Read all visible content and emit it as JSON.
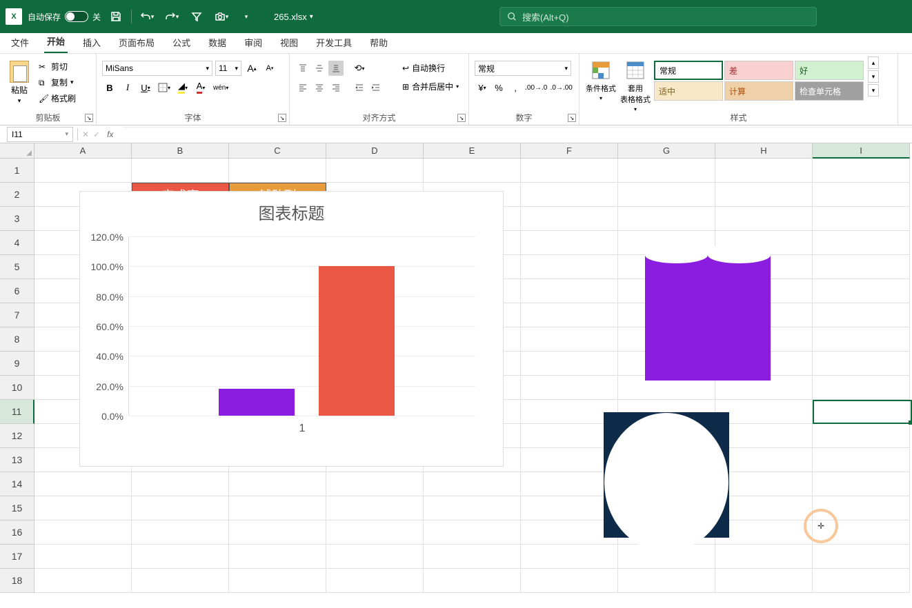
{
  "title_bar": {
    "autosave_label": "自动保存",
    "autosave_state": "关",
    "file_name": "265.xlsx"
  },
  "search": {
    "placeholder": "搜索(Alt+Q)"
  },
  "tabs": {
    "file": "文件",
    "home": "开始",
    "insert": "插入",
    "layout": "页面布局",
    "formulas": "公式",
    "data": "数据",
    "review": "审阅",
    "view": "视图",
    "dev": "开发工具",
    "help": "帮助"
  },
  "ribbon": {
    "clipboard": {
      "paste": "粘贴",
      "cut": "剪切",
      "copy": "复制",
      "painter": "格式刷",
      "label": "剪贴板"
    },
    "font": {
      "name": "MiSans",
      "size": "11",
      "label": "字体",
      "phonetic": "wén"
    },
    "align": {
      "wrap": "自动换行",
      "merge": "合并后居中",
      "label": "对齐方式"
    },
    "number": {
      "format": "常规",
      "label": "数字"
    },
    "styles": {
      "cond": "条件格式",
      "table": "套用\n表格格式",
      "label": "样式",
      "s_normal": "常规",
      "s_bad": "差",
      "s_good": "好",
      "s_neutral": "适中",
      "s_calc": "计算",
      "s_check": "检查单元格"
    }
  },
  "name_box": "I11",
  "sheet": {
    "cols": [
      "A",
      "B",
      "C",
      "D",
      "E",
      "F",
      "G",
      "H",
      "I"
    ],
    "row_count": 18,
    "b2": "完成率",
    "c2": "辅助列"
  },
  "chart_data": {
    "type": "bar",
    "title": "图表标题",
    "categories": [
      "1"
    ],
    "series": [
      {
        "name": "完成率",
        "values": [
          0.18
        ],
        "color": "#8a1de0"
      },
      {
        "name": "辅助列",
        "values": [
          1.0
        ],
        "color": "#ea5744"
      }
    ],
    "ylim": [
      0,
      1.2
    ],
    "yticks": [
      "0.0%",
      "20.0%",
      "40.0%",
      "60.0%",
      "80.0%",
      "100.0%",
      "120.0%"
    ],
    "xlabel": "",
    "ylabel": ""
  },
  "active_cell": "I11"
}
